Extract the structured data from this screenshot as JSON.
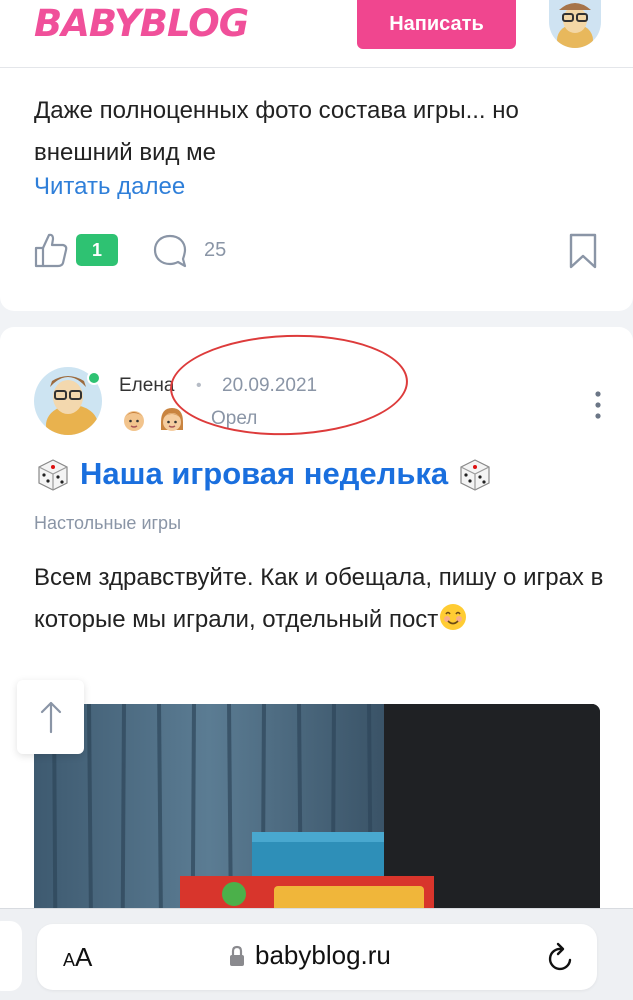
{
  "header": {
    "logo": "BABYBLOG",
    "write_button": "Написать",
    "brand_color": "#f0468f"
  },
  "prev_post": {
    "excerpt": "Даже полноценных фото состава игры... но внешний вид ме",
    "read_more": "Читать далее",
    "likes": "1",
    "comments": "25"
  },
  "post": {
    "author": "Елена",
    "date": "20.09.2021",
    "city": "Орел",
    "title": "Наша игровая неделька",
    "category": "Настольные игры",
    "text": "Всем здравствуйте. Как и обещала, пишу о играх в которые мы играли, отдельный пост",
    "title_color": "#1a6fde"
  },
  "browser": {
    "aa_small": "A",
    "aa_large": "A",
    "url": "babyblog.ru"
  },
  "icons": [
    "like-icon",
    "comment-icon",
    "bookmark-icon",
    "more-icon",
    "dice-icon",
    "smile-icon",
    "scroll-up-icon",
    "lock-icon",
    "reload-icon"
  ]
}
